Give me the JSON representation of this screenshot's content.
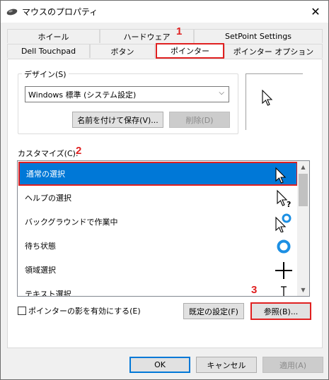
{
  "window": {
    "title": "マウスのプロパティ",
    "close_glyph": "✕"
  },
  "tabs_row1": [
    "ホイール",
    "ハードウェア",
    "SetPoint Settings"
  ],
  "tabs_row2": [
    "Dell Touchpad",
    "ボタン",
    "ポインター",
    "ポインター オプション"
  ],
  "active_tab": "ポインター",
  "markers": {
    "m1": "1",
    "m2": "2",
    "m3": "3"
  },
  "design": {
    "group_label": "デザイン(S)",
    "scheme_value": "Windows 標準 (システム設定)",
    "dropdown_glyph": "⌵",
    "save_as_label": "名前を付けて保存(V)...",
    "delete_label": "削除(D)"
  },
  "customize": {
    "label": "カスタマイズ(C):",
    "items": [
      {
        "label": "通常の選択",
        "icon": "normal-select-cursor-icon",
        "selected": true
      },
      {
        "label": "ヘルプの選択",
        "icon": "help-select-cursor-icon",
        "selected": false
      },
      {
        "label": "バックグラウンドで作業中",
        "icon": "working-in-background-cursor-icon",
        "selected": false
      },
      {
        "label": "待ち状態",
        "icon": "busy-cursor-icon",
        "selected": false
      },
      {
        "label": "領域選択",
        "icon": "precision-select-cursor-icon",
        "selected": false
      },
      {
        "label": "テキスト選択",
        "icon": "text-select-cursor-icon",
        "selected": false
      }
    ]
  },
  "shadow_checkbox": {
    "label": "ポインターの影を有効にする(E)",
    "checked": false
  },
  "buttons": {
    "default": "既定の設定(F)",
    "browse": "参照(B)...",
    "ok": "OK",
    "cancel": "キャンセル",
    "apply": "適用(A)"
  },
  "colors": {
    "accent": "#0078d7",
    "highlight": "#e02020"
  }
}
